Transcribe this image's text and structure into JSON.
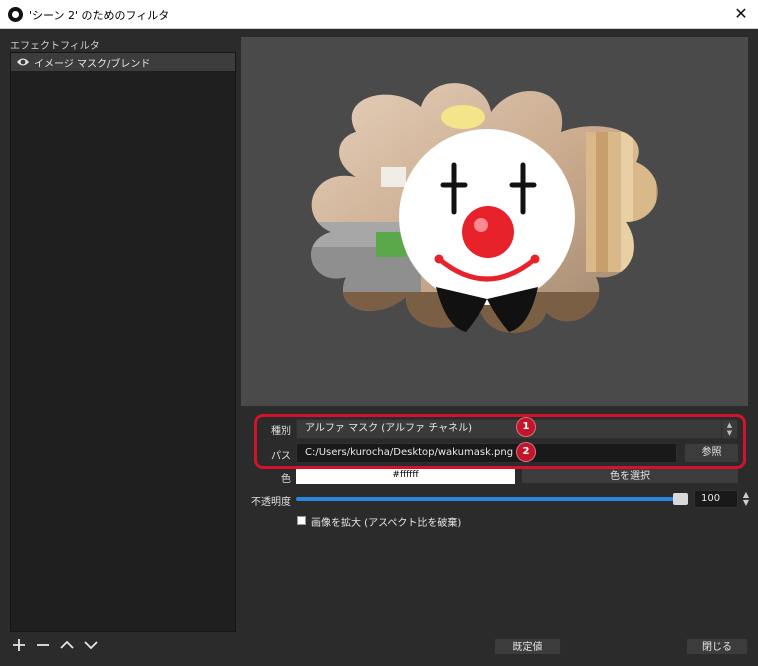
{
  "window": {
    "title": "'シーン 2' のためのフィルタ",
    "close_glyph": "✕"
  },
  "filters_panel": {
    "label": "エフェクトフィルタ",
    "items": [
      {
        "label": "イメージ マスク/ブレンド",
        "visible_icon": "eye-icon"
      }
    ],
    "buttons": [
      "add-icon",
      "remove-icon",
      "move-up-icon",
      "move-down-icon"
    ]
  },
  "form": {
    "type_label": "種別",
    "type_value": "アルファ マスク (アルファ チャネル)",
    "path_label": "パス",
    "path_value": "C:/Users/kurocha/Desktop/wakumask.png",
    "browse_label": "参照",
    "color_label": "色",
    "color_value": "#ffffff",
    "select_color_label": "色を選択",
    "opacity_label": "不透明度",
    "opacity_value": "100",
    "opacity_level": 1.0,
    "stretch_label": "画像を拡大 (アスペクト比を破棄)",
    "stretch_checked": false
  },
  "annotations": {
    "badge1": "1",
    "badge2": "2",
    "highlight_color": "#d3132c"
  },
  "footer": {
    "defaults_label": "既定値",
    "close_label": "閉じる"
  },
  "colors": {
    "accent_slider": "#2a87e0",
    "window_bg": "#2b2b2b"
  }
}
